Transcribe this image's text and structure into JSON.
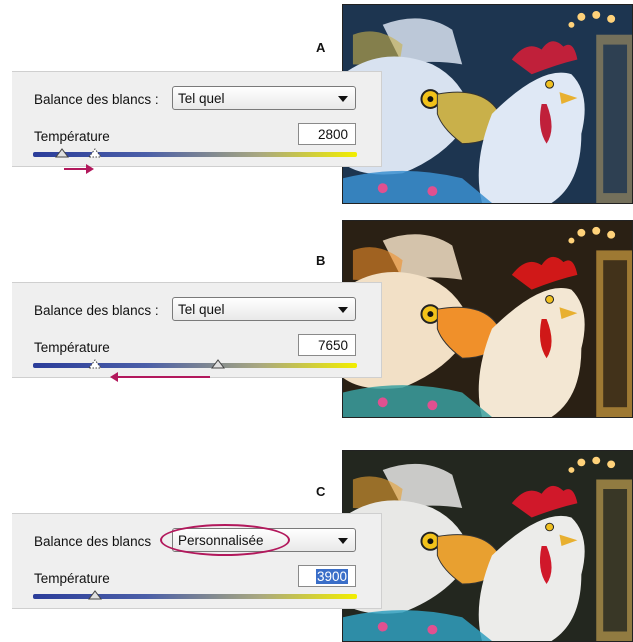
{
  "panels": [
    {
      "letter": "A",
      "white_balance_label": "Balance des blancs :",
      "white_balance_value": "Tel quel",
      "temperature_label": "Température",
      "temperature_value": "2800",
      "temperature_field_selected": false,
      "slider_level": 0.09,
      "ghost_thumb_level": 0.19,
      "arrow_direction": "right",
      "dropdown_highlighted": false,
      "photo_tint": "cool"
    },
    {
      "letter": "B",
      "white_balance_label": "Balance des blancs :",
      "white_balance_value": "Tel quel",
      "temperature_label": "Température",
      "temperature_value": "7650",
      "temperature_field_selected": false,
      "slider_level": 0.57,
      "ghost_thumb_level": 0.19,
      "arrow_direction": "left",
      "dropdown_highlighted": false,
      "photo_tint": "warm"
    },
    {
      "letter": "C",
      "white_balance_label": "Balance des blancs",
      "white_balance_value": "Personnalisée",
      "temperature_label": "Température",
      "temperature_value": "3900",
      "temperature_field_selected": true,
      "slider_level": 0.19,
      "ghost_thumb_level": null,
      "arrow_direction": null,
      "dropdown_highlighted": true,
      "photo_tint": "neutral"
    }
  ],
  "colors": {
    "annotation": "#b2185c",
    "panel_background": "#efefef",
    "track_cool": "#2b3d9a",
    "track_warm": "#f2ee00",
    "selection": "#3a6ec8"
  },
  "icons": [
    "chevron-down-icon",
    "slider-thumb-icon",
    "arrow-icon"
  ]
}
